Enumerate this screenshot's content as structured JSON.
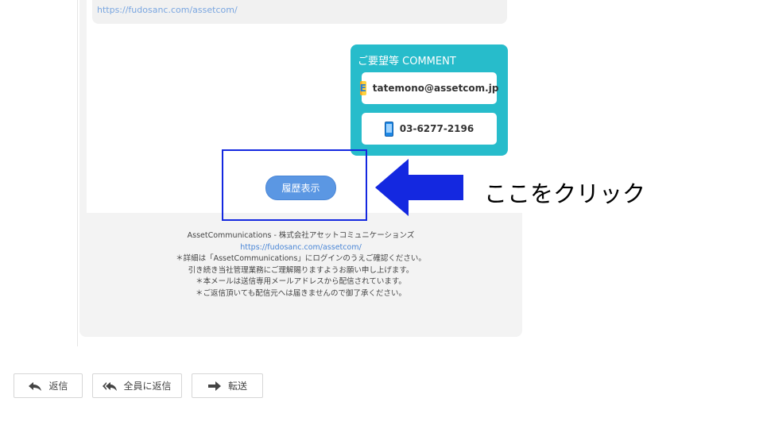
{
  "email": {
    "top_link_cut": "https://fudosanc.com/assetcom/",
    "comment": {
      "title": "ご要望等 COMMENT",
      "email": "tatemono@assetcom.jp",
      "email_icon_letter": "E",
      "phone": "03-6277-2196"
    },
    "history_button": "履歴表示",
    "footer": {
      "company": "AssetCommunications - 株式会社アセットコミュニケーションズ",
      "url": "https://fudosanc.com/assetcom/",
      "line1": "＊詳細は「AssetCommunications」にログインのうえご確認ください。",
      "line2": "引き続き当社管理業務にご理解賜りますようお願い申し上げます。",
      "line3": "＊本メールは送信専用メールアドレスから配信されています。",
      "line4": "＊ご返信頂いても配信元へは届きませんので御了承ください。"
    }
  },
  "annotation": {
    "text": "ここをクリック",
    "arrow_color": "#1428e0",
    "frame_color": "#1428e0"
  },
  "actions": {
    "reply": "返信",
    "reply_all": "全員に返信",
    "forward": "転送"
  },
  "colors": {
    "comment_bg": "#27bccb",
    "button_blue": "#5b97e3"
  }
}
